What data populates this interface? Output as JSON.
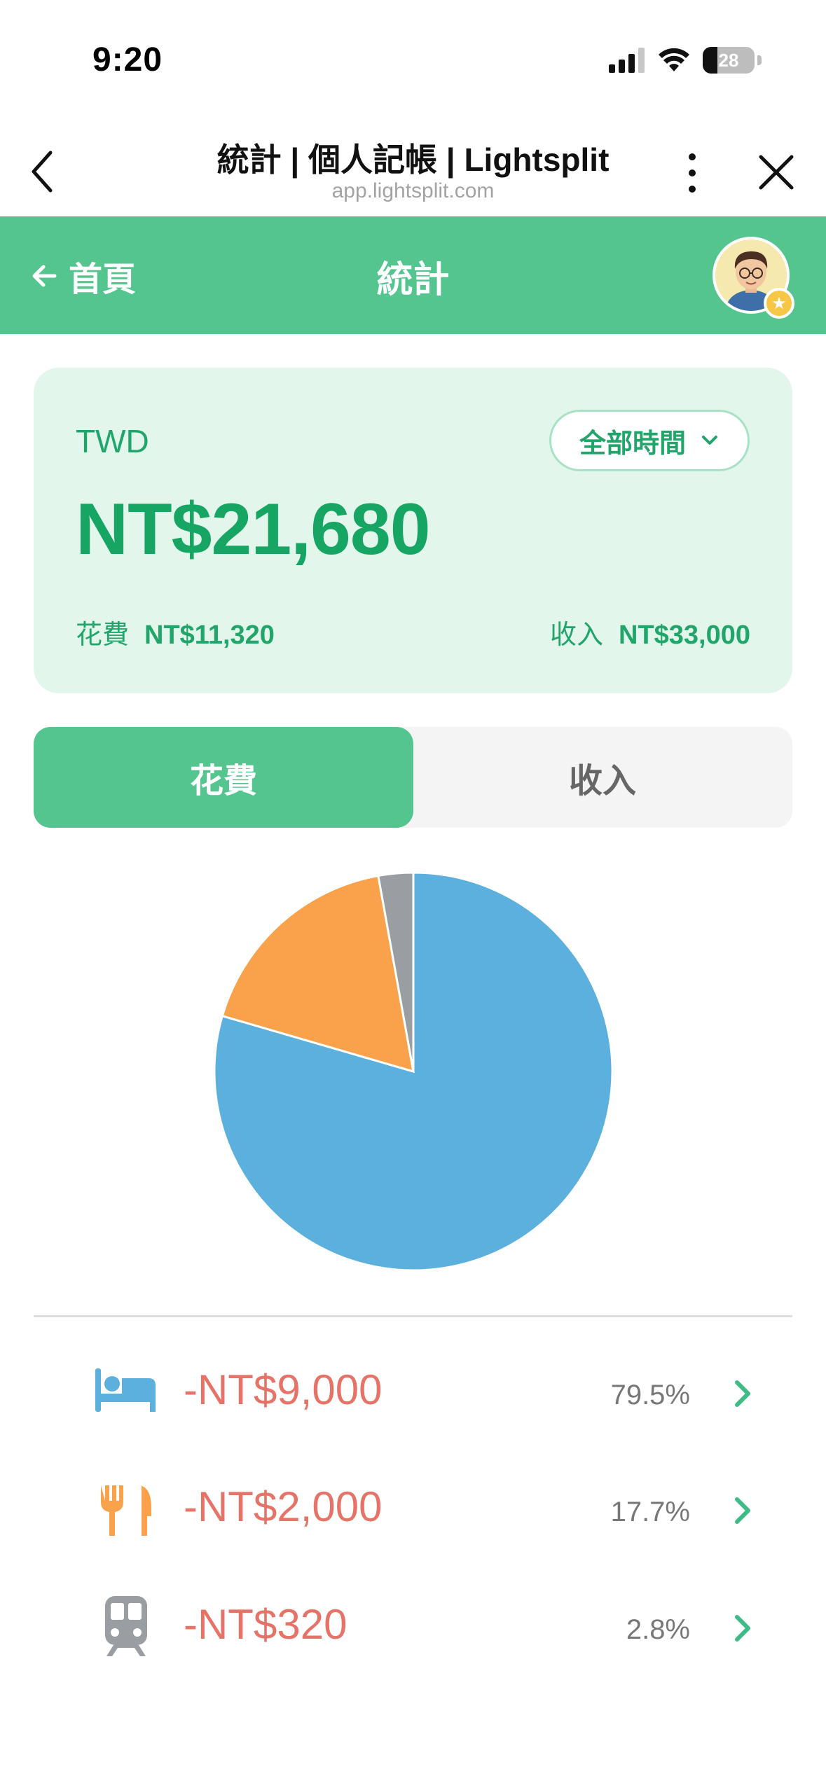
{
  "status_bar": {
    "time": "9:20",
    "battery": "28",
    "battery_level": 0.28
  },
  "browser": {
    "title": "統計 | 個人記帳 | Lightsplit",
    "url": "app.lightsplit.com"
  },
  "header": {
    "back_label": "首頁",
    "title": "統計"
  },
  "summary": {
    "currency": "TWD",
    "period": "全部時間",
    "balance": "NT$21,680",
    "spend_label": "花費",
    "spend_value": "NT$11,320",
    "income_label": "收入",
    "income_value": "NT$33,000"
  },
  "tabs": {
    "spend": "花費",
    "income": "收入",
    "active": "spend"
  },
  "chart_data": {
    "type": "pie",
    "categories": [
      "住宿",
      "餐飲",
      "交通"
    ],
    "values": [
      9000,
      2000,
      320
    ],
    "percentages": [
      79.5,
      17.7,
      2.8
    ],
    "colors": [
      "#5bb0de",
      "#f9a14b",
      "#9a9ea3"
    ]
  },
  "categories": [
    {
      "icon": "bed-icon",
      "amount": "-NT$9,000",
      "percent": "79.5%",
      "color": "#5bb0de"
    },
    {
      "icon": "fork-knife-icon",
      "amount": "-NT$2,000",
      "percent": "17.7%",
      "color": "#f9a14b"
    },
    {
      "icon": "train-icon",
      "amount": "-NT$320",
      "percent": "2.8%",
      "color": "#9a9ea3"
    }
  ],
  "colors": {
    "brand": "#55c58f",
    "positive": "#17a563",
    "negative": "#e57367"
  }
}
